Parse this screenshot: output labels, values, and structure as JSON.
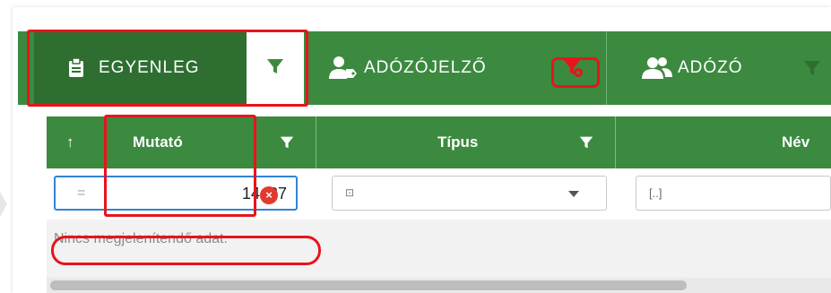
{
  "tabs": {
    "egyenleg": {
      "label": "EGYENLEG"
    },
    "adozojelzo": {
      "label": "ADÓZÓJELZŐ"
    },
    "adozo": {
      "label": "ADÓZÓ"
    }
  },
  "grid": {
    "sort_icon": "↑",
    "columns": [
      {
        "label": "Mutató"
      },
      {
        "label": "Típus"
      },
      {
        "label": "Név"
      }
    ],
    "filters": {
      "mutato_operator": "=",
      "mutato_value": "14437",
      "tipus_icon_text": "⊡",
      "nev_icon_text": "[..]"
    },
    "no_data": "Nincs megjelenítendő adat."
  },
  "colors": {
    "accent": "#3b8a3f",
    "accent_dark": "#2e6f31",
    "highlight": "#e8141b",
    "focus": "#2f83d6"
  },
  "icons": [
    "clipboard-icon",
    "funnel-icon",
    "user-tag-icon",
    "funnel-gear-icon",
    "users-icon",
    "clear-icon",
    "sort-up-icon"
  ]
}
